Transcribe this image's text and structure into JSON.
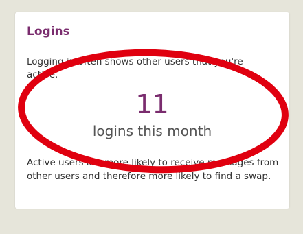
{
  "card": {
    "title": "Logins",
    "intro": "Logging in often shows other users that you're active.",
    "stat": {
      "value": "11",
      "label": "logins this month"
    },
    "outro": "Active users are more likely to receive messages from other users and therefore more likely to find a swap."
  },
  "colors": {
    "accent": "#7a2c6e",
    "background": "#e6e5da",
    "annotation": "#e0000f"
  }
}
